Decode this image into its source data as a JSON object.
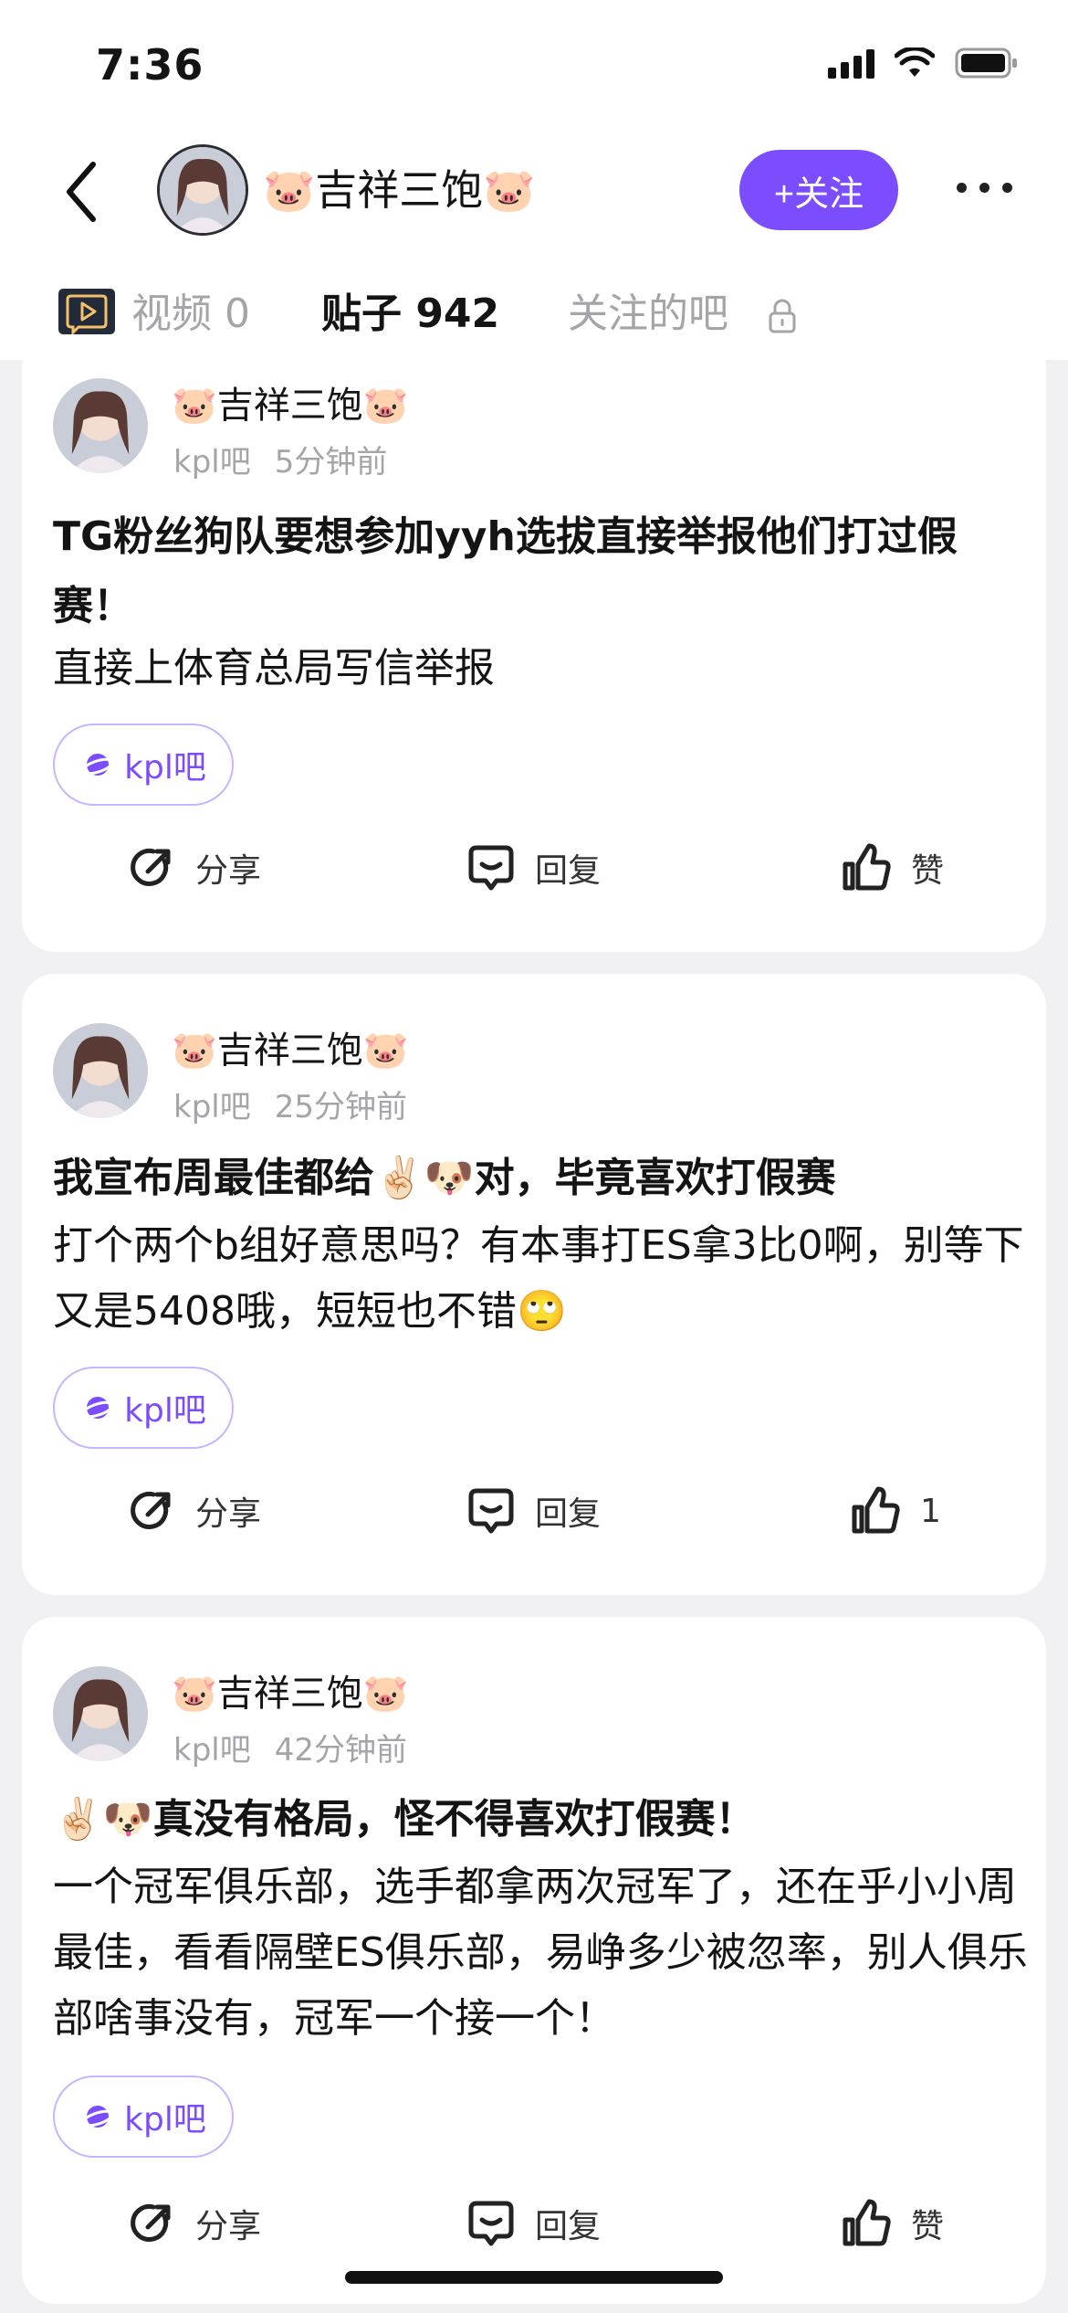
{
  "status_bar": {
    "time": "7:36"
  },
  "header": {
    "profile_name": "🐷吉祥三饱🐷",
    "follow_label": "+关注",
    "accent_color": "#7c4dff"
  },
  "tabs": [
    {
      "label": "视频 0"
    },
    {
      "label": "贴子 942"
    },
    {
      "label": "关注的吧"
    }
  ],
  "posts": [
    {
      "author": "🐷吉祥三饱🐷",
      "forum": "kpl吧",
      "time": "5分钟前",
      "title": "TG粉丝狗队要想参加yyh选拔直接举报他们打过假赛！",
      "body": "直接上体育总局写信举报",
      "tag": "kpl吧",
      "share_label": "分享",
      "reply_label": "回复",
      "like_label": "赞"
    },
    {
      "author": "🐷吉祥三饱🐷",
      "forum": "kpl吧",
      "time": "25分钟前",
      "title": "我宣布周最佳都给✌🏻🐶对，毕竟喜欢打假赛",
      "body": "打个两个b组好意思吗？有本事打ES拿3比0啊，别等下又是5408哦，短短也不错🙄",
      "tag": "kpl吧",
      "share_label": "分享",
      "reply_label": "回复",
      "like_label": "1"
    },
    {
      "author": "🐷吉祥三饱🐷",
      "forum": "kpl吧",
      "time": "42分钟前",
      "title": "✌🏻🐶真没有格局，怪不得喜欢打假赛！",
      "body": "一个冠军俱乐部，选手都拿两次冠军了，还在乎小小周最佳，看看隔壁ES俱乐部，易峥多少被忽率，别人俱乐部啥事没有，冠军一个接一个！",
      "tag": "kpl吧",
      "share_label": "分享",
      "reply_label": "回复",
      "like_label": "赞"
    }
  ]
}
